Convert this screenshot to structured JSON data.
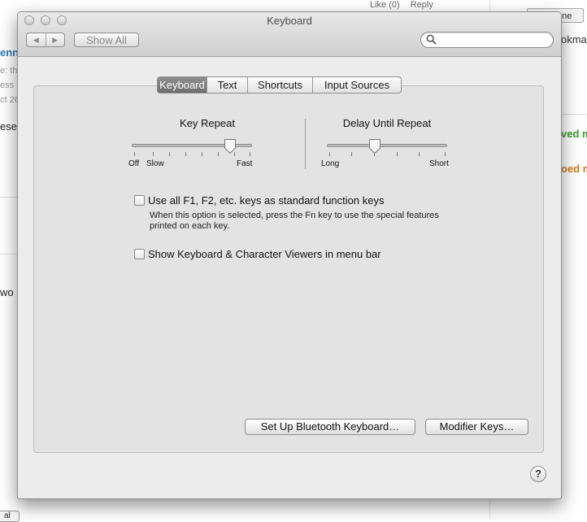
{
  "background": {
    "topbar": {
      "like": "Like (0)",
      "reply": "Reply"
    },
    "left_fragments": [
      "enn",
      "e: th",
      "ess",
      "ct 26",
      "ese",
      "wo"
    ],
    "right_fragments": {
      "none_button": "one",
      "bookmark": "okma",
      "green": "ved m",
      "orange": "oed m"
    },
    "bottom_button": "al"
  },
  "window": {
    "title": "Keyboard",
    "toolbar": {
      "back_glyph": "◀",
      "forward_glyph": "▶",
      "show_all": "Show All",
      "search_placeholder": "",
      "search_value": ""
    },
    "tabs": [
      {
        "label": "Keyboard",
        "active": true
      },
      {
        "label": "Text",
        "active": false
      },
      {
        "label": "Shortcuts",
        "active": false
      },
      {
        "label": "Input Sources",
        "active": false
      }
    ],
    "sliders": {
      "key_repeat": {
        "title": "Key Repeat",
        "labels": {
          "off": "Off",
          "slow": "Slow",
          "fast": "Fast"
        },
        "value_fraction": 0.8
      },
      "delay_until_repeat": {
        "title": "Delay Until Repeat",
        "labels": {
          "long": "Long",
          "short": "Short"
        },
        "value_fraction": 0.4
      }
    },
    "checkboxes": {
      "fn_keys": {
        "label": "Use all F1, F2, etc. keys as standard function keys",
        "help": "When this option is selected, press the Fn key to use the special features printed on each key.",
        "checked": false
      },
      "viewers": {
        "label": "Show Keyboard & Character Viewers in menu bar",
        "checked": false
      }
    },
    "buttons": {
      "bluetooth": "Set Up Bluetooth Keyboard…",
      "modifier": "Modifier Keys…",
      "help": "?"
    }
  },
  "colors": {
    "window_bg": "#ececec",
    "panel_bg": "#e3e3e3",
    "active_tab": "#7a7a7a",
    "link_blue": "#2a7ab5",
    "green": "#3b9a2b",
    "orange": "#d07a16"
  }
}
